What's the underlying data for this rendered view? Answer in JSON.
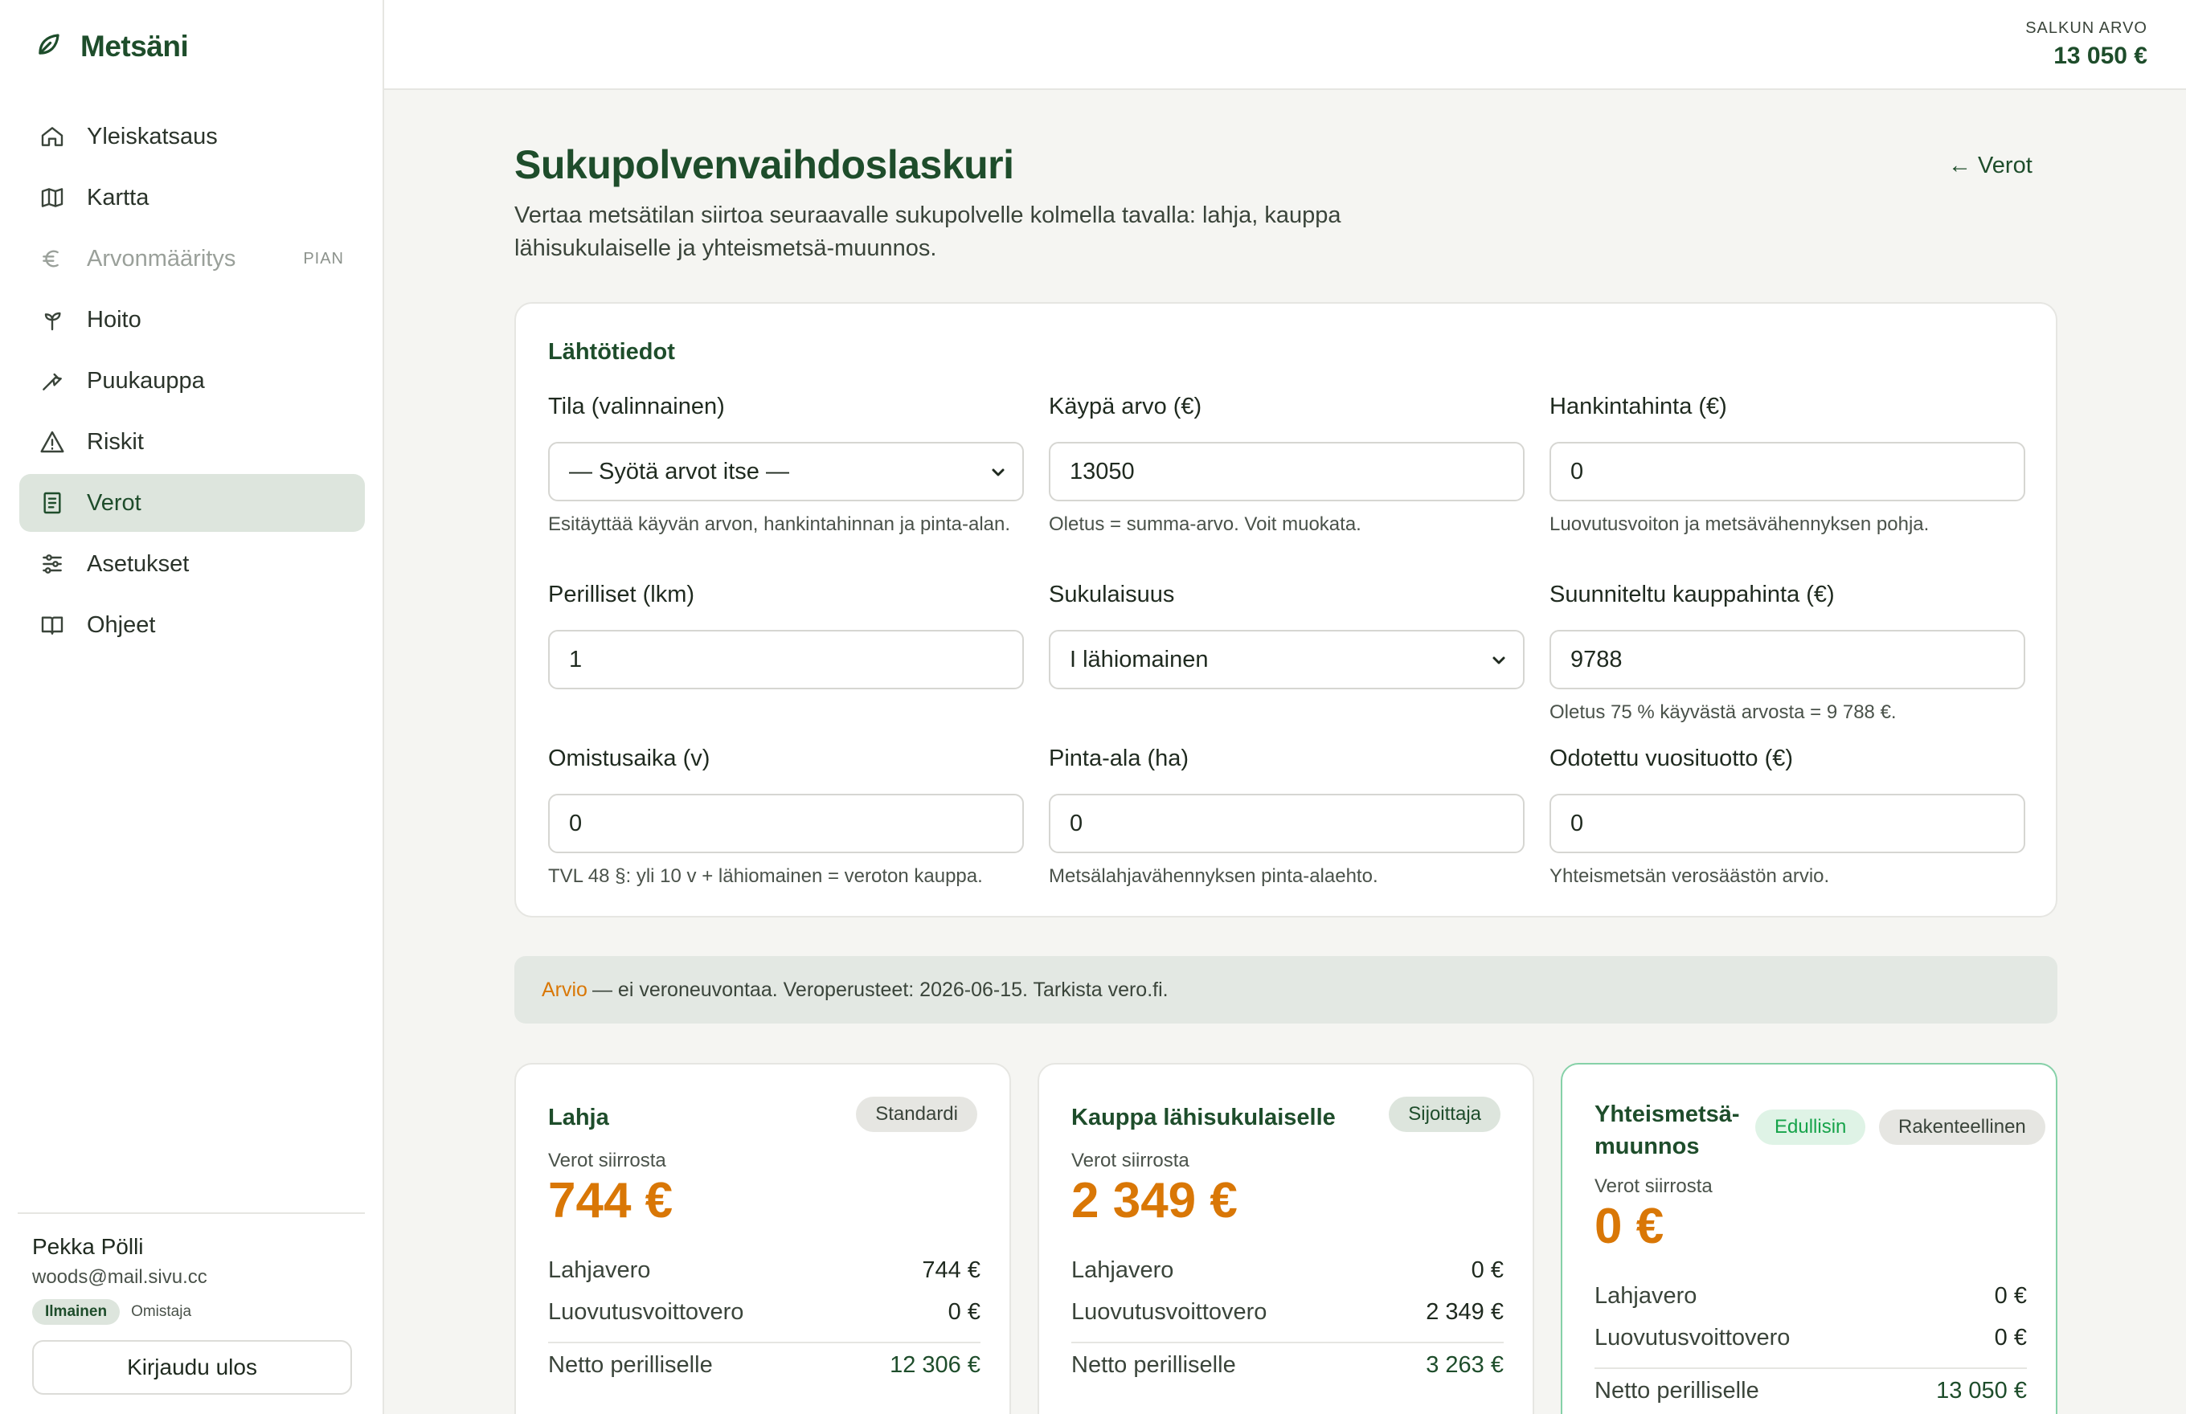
{
  "app": {
    "name": "Metsäni"
  },
  "sidebar": {
    "items": [
      {
        "label": "Yleiskatsaus",
        "icon": "home-icon"
      },
      {
        "label": "Kartta",
        "icon": "map-icon"
      },
      {
        "label": "Arvonmääritys",
        "icon": "euro-icon",
        "badge": "PIAN",
        "disabled": true
      },
      {
        "label": "Hoito",
        "icon": "sprout-icon"
      },
      {
        "label": "Puukauppa",
        "icon": "axe-icon"
      },
      {
        "label": "Riskit",
        "icon": "warning-icon"
      },
      {
        "label": "Verot",
        "icon": "receipt-icon",
        "active": true
      },
      {
        "label": "Asetukset",
        "icon": "sliders-icon"
      },
      {
        "label": "Ohjeet",
        "icon": "book-icon"
      }
    ],
    "user": {
      "name": "Pekka Pölli",
      "email": "woods@mail.sivu.cc",
      "plan": "Ilmainen",
      "role": "Omistaja"
    },
    "logout_label": "Kirjaudu ulos"
  },
  "header": {
    "portfolio_label": "SALKUN ARVO",
    "portfolio_value": "13 050 €"
  },
  "page": {
    "title": "Sukupolvenvaihdoslaskuri",
    "back_link": "← Verot",
    "subtitle": "Vertaa metsätilan siirtoa seuraavalle sukupolvelle kolmella tavalla: lahja, kauppa lähisukulaiselle ja yhteismetsä-muunnos."
  },
  "inputs": {
    "section_title": "Lähtötiedot",
    "fields": [
      {
        "label": "Tila (valinnainen)",
        "value": "— Syötä arvot itse —",
        "type": "select",
        "help": "Esitäyttää käyvän arvon, hankintahinnan ja pinta-alan."
      },
      {
        "label": "Käypä arvo (€)",
        "value": "13050",
        "type": "input",
        "help": "Oletus = summa-arvo. Voit muokata."
      },
      {
        "label": "Hankintahinta (€)",
        "value": "0",
        "type": "input",
        "help": "Luovutusvoiton ja metsävähennyksen pohja."
      },
      {
        "label": "Perilliset (lkm)",
        "value": "1",
        "type": "input",
        "help": ""
      },
      {
        "label": "Sukulaisuus",
        "value": "I lähiomainen",
        "type": "select",
        "help": ""
      },
      {
        "label": "Suunniteltu kauppahinta (€)",
        "value": "9788",
        "type": "input",
        "help": "Oletus 75 % käyvästä arvosta = 9 788 €."
      },
      {
        "label": "Omistusaika (v)",
        "value": "0",
        "type": "input",
        "help": "TVL 48 §: yli 10 v + lähiomainen = veroton kauppa."
      },
      {
        "label": "Pinta-ala (ha)",
        "value": "0",
        "type": "input",
        "help": "Metsälahjavähennyksen pinta-alaehto."
      },
      {
        "label": "Odotettu vuosituotto (€)",
        "value": "0",
        "type": "input",
        "help": "Yhteismetsän verosäästön arvio."
      }
    ]
  },
  "notice": {
    "accent": "Arvio",
    "text": "— ei veroneuvontaa. Veroperusteet: 2026-06-15. Tarkista vero.fi."
  },
  "results": [
    {
      "title": "Lahja",
      "badges": [
        "Standardi"
      ],
      "sub": "Verot siirrosta",
      "amount": "744 €",
      "rows": [
        {
          "label": "Lahjavero",
          "value": "744 €"
        },
        {
          "label": "Luovutusvoittovero",
          "value": "0 €"
        }
      ],
      "net": {
        "label": "Netto perilliselle",
        "value": "12 306 €"
      }
    },
    {
      "title": "Kauppa lähisukulaiselle",
      "badges": [
        "Sijoittaja"
      ],
      "sub": "Verot siirrosta",
      "amount": "2 349 €",
      "rows": [
        {
          "label": "Lahjavero",
          "value": "0 €"
        },
        {
          "label": "Luovutusvoittovero",
          "value": "2 349 €"
        }
      ],
      "net": {
        "label": "Netto perilliselle",
        "value": "3 263 €"
      }
    },
    {
      "title": "Yhteismetsä-muunnos",
      "title_line1": "Yhteismetsä-",
      "title_line2": "muunnos",
      "badges": [
        "Edullisin",
        "Rakenteellinen"
      ],
      "sub": "Verot siirrosta",
      "amount": "0 €",
      "rows": [
        {
          "label": "Lahjavero",
          "value": "0 €"
        },
        {
          "label": "Luovutusvoittovero",
          "value": "0 €"
        }
      ],
      "net": {
        "label": "Netto perilliselle",
        "value": "13 050 €"
      }
    }
  ],
  "colors": {
    "brand": "#1e4d2b",
    "accent": "#d97706",
    "best": "#16a34a"
  }
}
